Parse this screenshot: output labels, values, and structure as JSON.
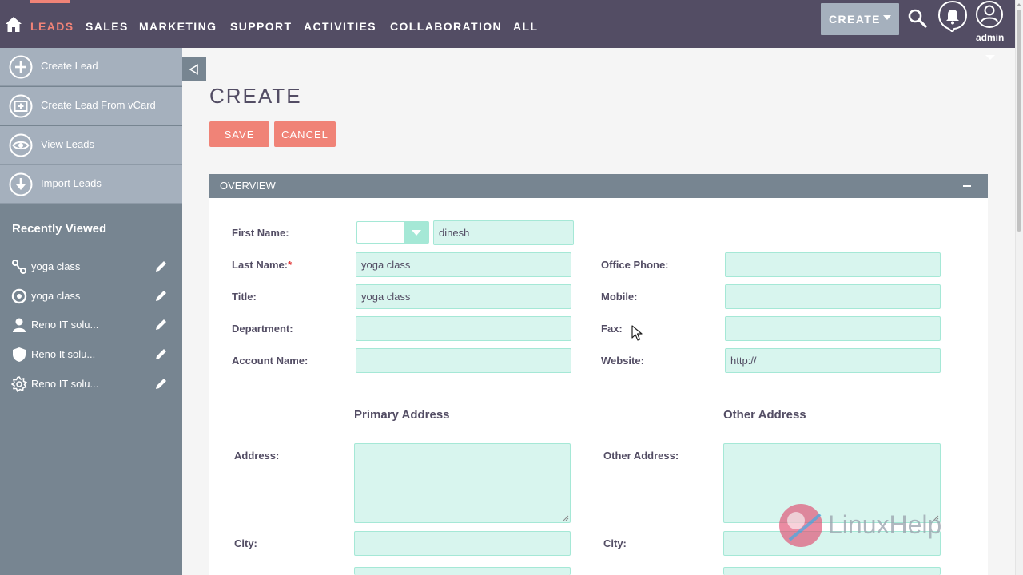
{
  "nav": {
    "items": [
      "LEADS",
      "SALES",
      "MARKETING",
      "SUPPORT",
      "ACTIVITIES",
      "COLLABORATION",
      "ALL"
    ],
    "active": "LEADS",
    "create_label": "CREATE",
    "user_label": "admin",
    "accent_color": "#f08377",
    "bar_color": "#534d64"
  },
  "sidebar": {
    "actions": [
      {
        "label": "Create Lead",
        "icon": "plus-circle-icon"
      },
      {
        "label": "Create Lead From vCard",
        "icon": "vcard-icon"
      },
      {
        "label": "View Leads",
        "icon": "eye-icon"
      },
      {
        "label": "Import Leads",
        "icon": "download-circle-icon"
      }
    ],
    "recent_title": "Recently Viewed",
    "recent": [
      {
        "label": "yoga class",
        "icon": "target-link-icon"
      },
      {
        "label": "yoga class",
        "icon": "target-circle-icon"
      },
      {
        "label": "Reno IT solu...",
        "icon": "person-icon"
      },
      {
        "label": "Reno It solu...",
        "icon": "shield-icon"
      },
      {
        "label": "Reno IT solu...",
        "icon": "gear-icon"
      }
    ]
  },
  "page": {
    "title": "CREATE",
    "save_label": "SAVE",
    "cancel_label": "CANCEL"
  },
  "panel": {
    "title": "OVERVIEW"
  },
  "form": {
    "first_name_label": "First Name:",
    "first_name_value": "dinesh",
    "salutation_value": "",
    "last_name_label": "Last Name:",
    "required_mark": "*",
    "last_name_value": "yoga class",
    "title_label": "Title:",
    "title_value": "yoga class",
    "department_label": "Department:",
    "department_value": "",
    "account_name_label": "Account Name:",
    "account_name_value": "",
    "office_phone_label": "Office Phone:",
    "office_phone_value": "",
    "mobile_label": "Mobile:",
    "mobile_value": "",
    "fax_label": "Fax:",
    "fax_value": "",
    "website_label": "Website:",
    "website_value": "http://",
    "primary_address_title": "Primary Address",
    "other_address_title": "Other Address",
    "address_label": "Address:",
    "other_address_label": "Other Address:",
    "city_label": "City:",
    "other_city_label": "City:"
  },
  "watermark": {
    "text": "LinuxHelp"
  }
}
